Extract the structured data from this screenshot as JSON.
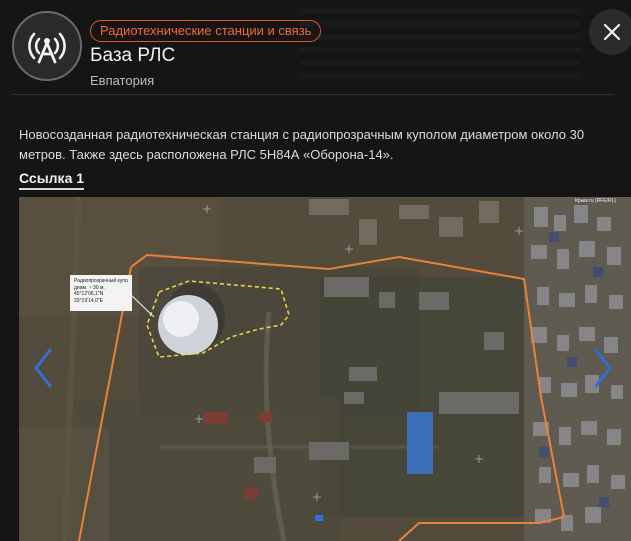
{
  "header": {
    "category": "Радиотехнические станции и связь",
    "title": "База РЛС",
    "subtitle": "Евпатория",
    "avatar_icon": "radio-tower-icon",
    "close_icon": "close-icon"
  },
  "body": {
    "description": "Новосозданная радиотехническая станция с радиопрозрачным куполом диаметром около 30 метров. Также здесь расположена РЛС 5Н84А «Оборона-14».",
    "link_label": "Ссылка 1"
  },
  "image": {
    "credit": "Крым.ru (RFE/RL)",
    "annotation": {
      "line1": "Радиопрозрачный купол",
      "line2": "диам. ~ 30 м.",
      "line3": "45°12'06,1\"N",
      "line4": "33°19'14,0\"E"
    },
    "prev_icon": "chevron-left-icon",
    "next_icon": "chevron-right-icon"
  },
  "colors": {
    "accent": "#f06a35",
    "background": "#151515",
    "nav_arrow": "#2f6fd6",
    "perimeter": "#e8823a",
    "dome_outline": "#e8d24a"
  }
}
